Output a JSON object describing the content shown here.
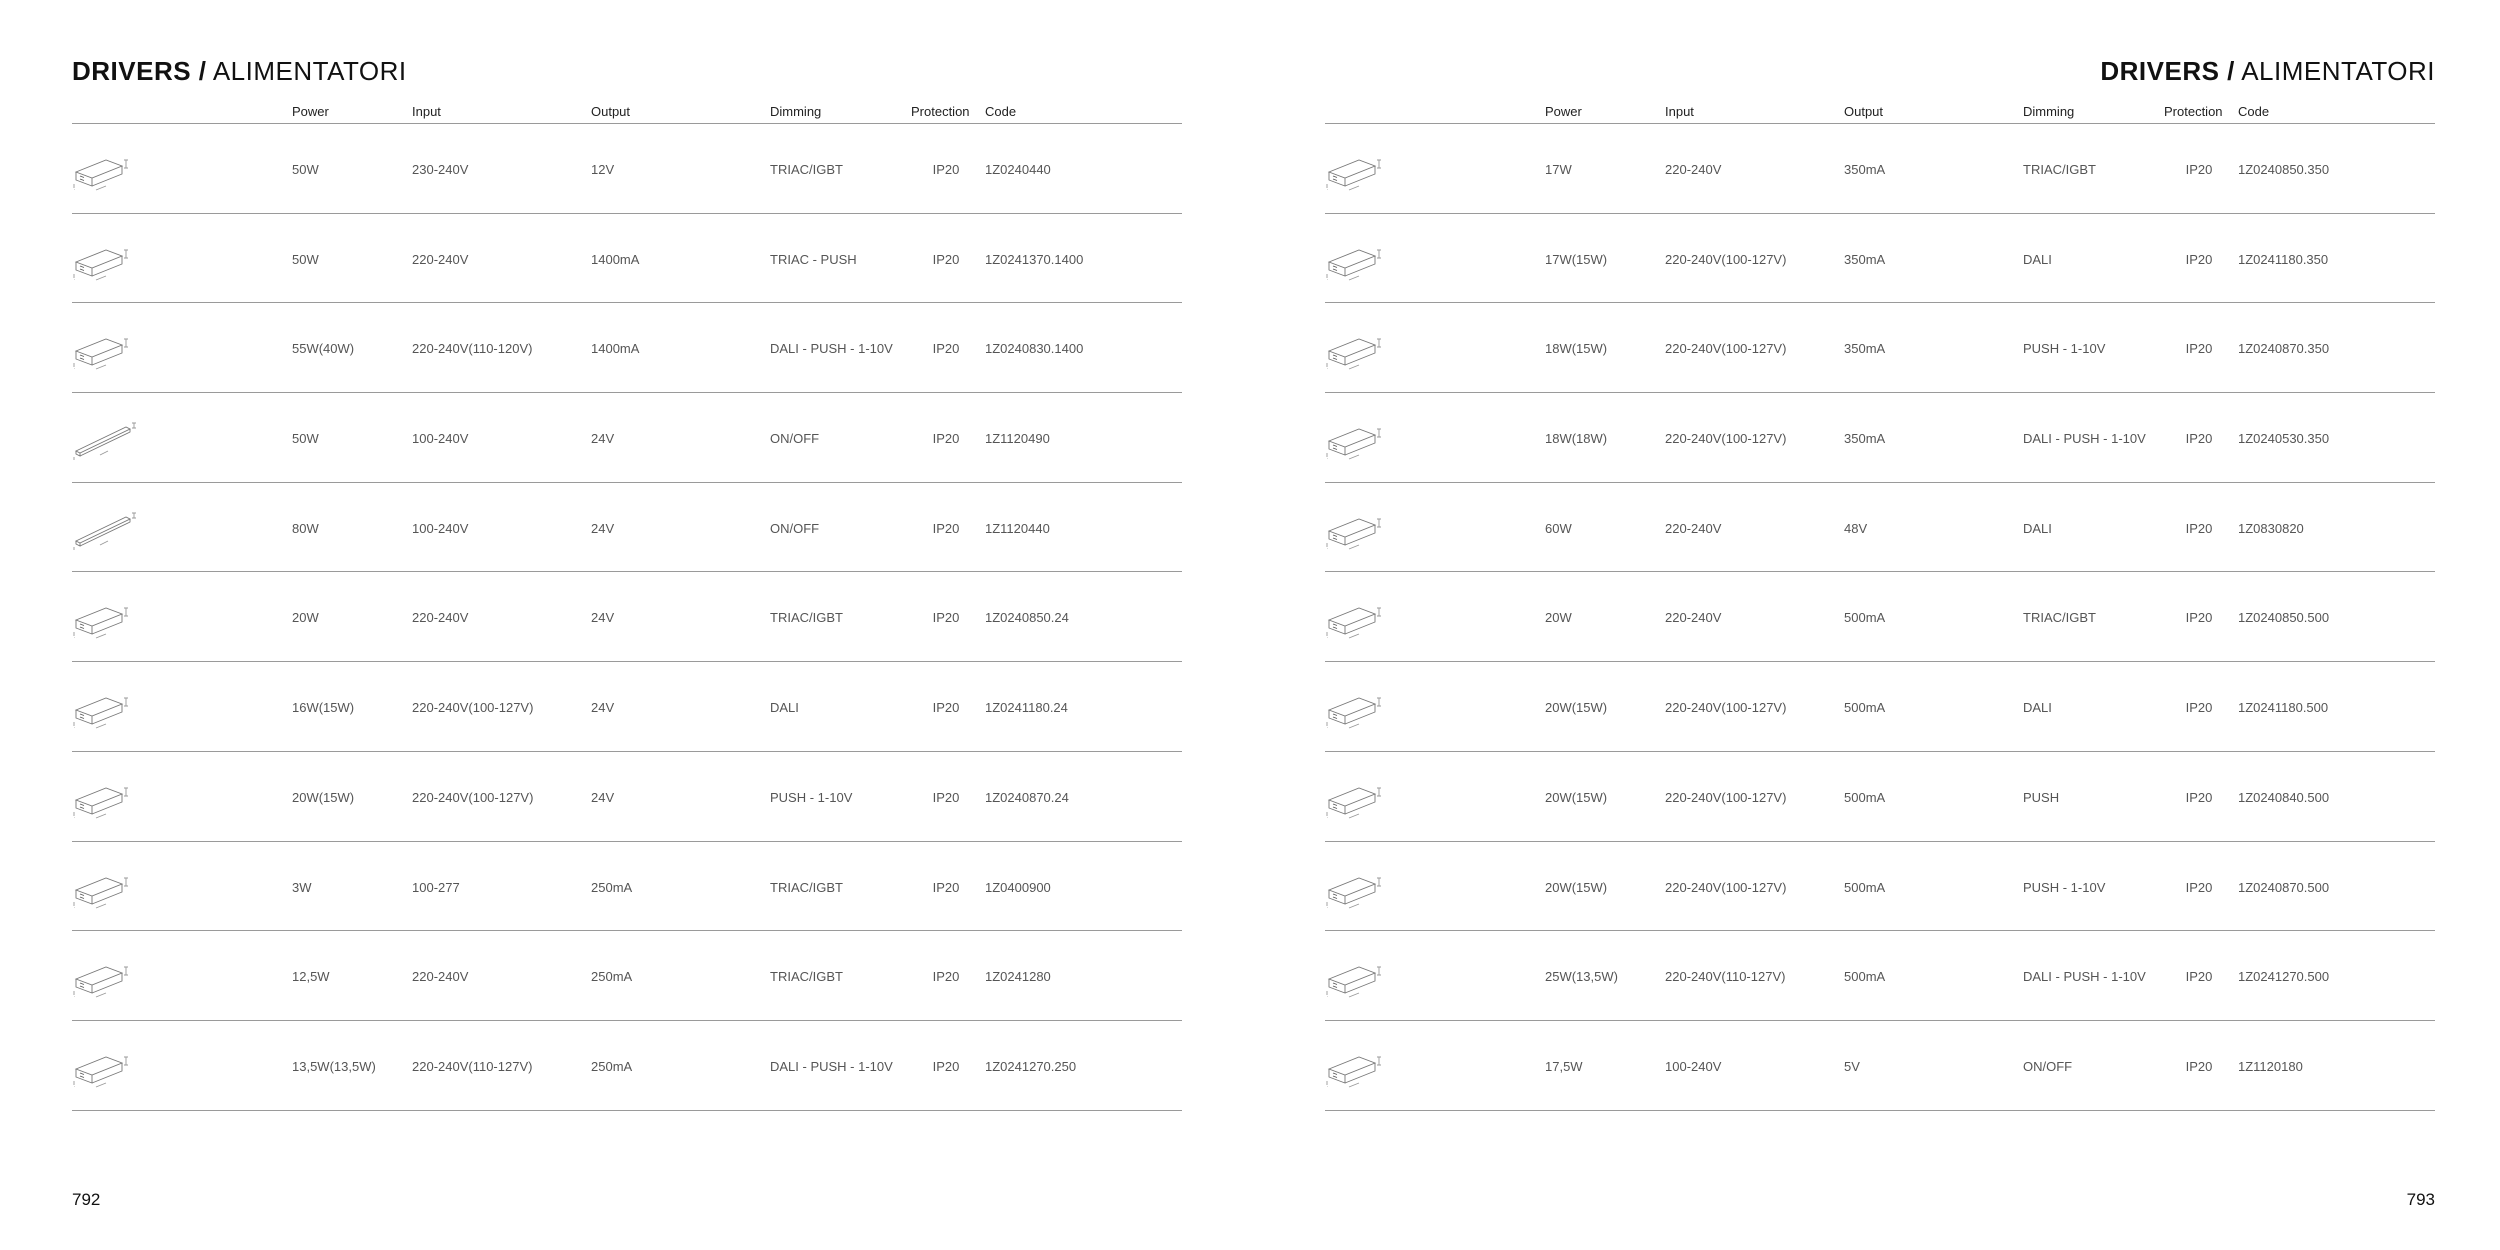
{
  "headers": {
    "power": "Power",
    "input": "Input",
    "output": "Output",
    "dimming": "Dimming",
    "protection": "Protection",
    "code": "Code"
  },
  "left_page": {
    "title_strong": "DRIVERS /",
    "title_light": " ALIMENTATORI",
    "page_number": "792",
    "rows": [
      {
        "thumb": "driver-box-thumbnail",
        "power": "50W",
        "input": "230-240V",
        "output": "12V",
        "dimming": "TRIAC/IGBT",
        "protection": "IP20",
        "code": "1Z0240440"
      },
      {
        "thumb": "driver-box-thumbnail",
        "power": "50W",
        "input": "220-240V",
        "output": "1400mA",
        "dimming": "TRIAC - PUSH",
        "protection": "IP20",
        "code": "1Z0241370.1400"
      },
      {
        "thumb": "driver-box-thumbnail",
        "power": "55W(40W)",
        "input": "220-240V(110-120V)",
        "output": "1400mA",
        "dimming": "DALI - PUSH - 1-10V",
        "protection": "IP20",
        "code": "1Z0240830.1400"
      },
      {
        "thumb": "driver-slim-thumbnail",
        "power": "50W",
        "input": "100-240V",
        "output": "24V",
        "dimming": "ON/OFF",
        "protection": "IP20",
        "code": "1Z1120490"
      },
      {
        "thumb": "driver-slim-thumbnail",
        "power": "80W",
        "input": "100-240V",
        "output": "24V",
        "dimming": "ON/OFF",
        "protection": "IP20",
        "code": "1Z1120440"
      },
      {
        "thumb": "driver-box-thumbnail",
        "power": "20W",
        "input": "220-240V",
        "output": "24V",
        "dimming": "TRIAC/IGBT",
        "protection": "IP20",
        "code": "1Z0240850.24"
      },
      {
        "thumb": "driver-box-thumbnail",
        "power": "16W(15W)",
        "input": "220-240V(100-127V)",
        "output": "24V",
        "dimming": "DALI",
        "protection": "IP20",
        "code": "1Z0241180.24"
      },
      {
        "thumb": "driver-box-thumbnail",
        "power": "20W(15W)",
        "input": "220-240V(100-127V)",
        "output": "24V",
        "dimming": "PUSH - 1-10V",
        "protection": "IP20",
        "code": "1Z0240870.24"
      },
      {
        "thumb": "driver-box-thumbnail",
        "power": "3W",
        "input": "100-277",
        "output": "250mA",
        "dimming": "TRIAC/IGBT",
        "protection": "IP20",
        "code": "1Z0400900"
      },
      {
        "thumb": "driver-box-thumbnail",
        "power": "12,5W",
        "input": "220-240V",
        "output": "250mA",
        "dimming": "TRIAC/IGBT",
        "protection": "IP20",
        "code": "1Z0241280"
      },
      {
        "thumb": "driver-box-thumbnail",
        "power": "13,5W(13,5W)",
        "input": "220-240V(110-127V)",
        "output": "250mA",
        "dimming": "DALI - PUSH - 1-10V",
        "protection": "IP20",
        "code": "1Z0241270.250"
      }
    ]
  },
  "right_page": {
    "title_strong": "DRIVERS /",
    "title_light": " ALIMENTATORI",
    "page_number": "793",
    "rows": [
      {
        "thumb": "driver-box-thumbnail",
        "power": "17W",
        "input": "220-240V",
        "output": "350mA",
        "dimming": "TRIAC/IGBT",
        "protection": "IP20",
        "code": "1Z0240850.350"
      },
      {
        "thumb": "driver-box-thumbnail",
        "power": "17W(15W)",
        "input": "220-240V(100-127V)",
        "output": "350mA",
        "dimming": "DALI",
        "protection": "IP20",
        "code": "1Z0241180.350"
      },
      {
        "thumb": "driver-box-thumbnail",
        "power": "18W(15W)",
        "input": "220-240V(100-127V)",
        "output": "350mA",
        "dimming": "PUSH - 1-10V",
        "protection": "IP20",
        "code": "1Z0240870.350"
      },
      {
        "thumb": "driver-box-thumbnail",
        "power": "18W(18W)",
        "input": "220-240V(100-127V)",
        "output": "350mA",
        "dimming": "DALI - PUSH - 1-10V",
        "protection": "IP20",
        "code": "1Z0240530.350"
      },
      {
        "thumb": "driver-box-thumbnail",
        "power": "60W",
        "input": "220-240V",
        "output": "48V",
        "dimming": "DALI",
        "protection": "IP20",
        "code": "1Z0830820"
      },
      {
        "thumb": "driver-box-thumbnail",
        "power": "20W",
        "input": "220-240V",
        "output": "500mA",
        "dimming": "TRIAC/IGBT",
        "protection": "IP20",
        "code": "1Z0240850.500"
      },
      {
        "thumb": "driver-box-thumbnail",
        "power": "20W(15W)",
        "input": "220-240V(100-127V)",
        "output": "500mA",
        "dimming": "DALI",
        "protection": "IP20",
        "code": "1Z0241180.500"
      },
      {
        "thumb": "driver-box-thumbnail",
        "power": "20W(15W)",
        "input": "220-240V(100-127V)",
        "output": "500mA",
        "dimming": "PUSH",
        "protection": "IP20",
        "code": "1Z0240840.500"
      },
      {
        "thumb": "driver-box-thumbnail",
        "power": "20W(15W)",
        "input": "220-240V(100-127V)",
        "output": "500mA",
        "dimming": "PUSH - 1-10V",
        "protection": "IP20",
        "code": "1Z0240870.500"
      },
      {
        "thumb": "driver-box-thumbnail",
        "power": "25W(13,5W)",
        "input": "220-240V(110-127V)",
        "output": "500mA",
        "dimming": "DALI - PUSH - 1-10V",
        "protection": "IP20",
        "code": "1Z0241270.500"
      },
      {
        "thumb": "driver-box-thumbnail",
        "power": "17,5W",
        "input": "100-240V",
        "output": "5V",
        "dimming": "ON/OFF",
        "protection": "IP20",
        "code": "1Z1120180"
      }
    ]
  }
}
